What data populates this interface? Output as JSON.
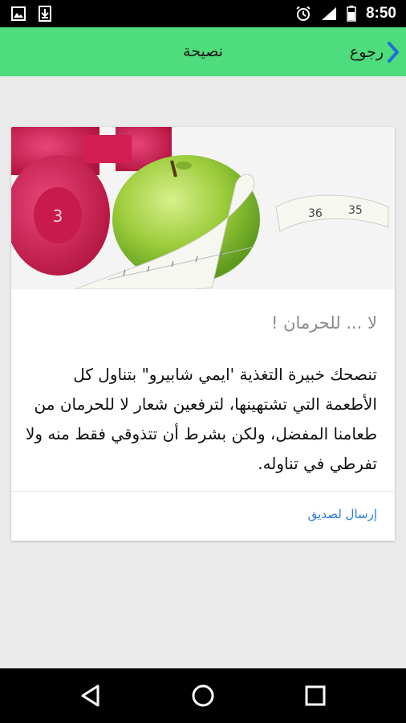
{
  "status_bar": {
    "time": "8:50",
    "icons": [
      "image-notification-icon",
      "download-notification-icon",
      "alarm-icon",
      "signal-icon",
      "battery-icon"
    ]
  },
  "action_bar": {
    "back_label": "رجوع",
    "title": "نصيحة",
    "color": "#4fdc7c"
  },
  "card": {
    "image": "green apple with measuring tape and pink dumbbells",
    "heading": "لا ... للحرمان !",
    "body": "تنصحك خبيرة التغذية 'ايمي شابيرو\" بتناول كل الأطعمة التي تشتهينها، لترفعين شعار لا للحرمان من طعامنا المفضل، ولكن بشرط أن تتذوقي فقط منه ولا تفرطي في تناوله.",
    "share_label": "إرسال لصديق"
  },
  "nav_bar": {
    "buttons": [
      "back-nav-icon",
      "home-nav-icon",
      "recents-nav-icon"
    ]
  }
}
